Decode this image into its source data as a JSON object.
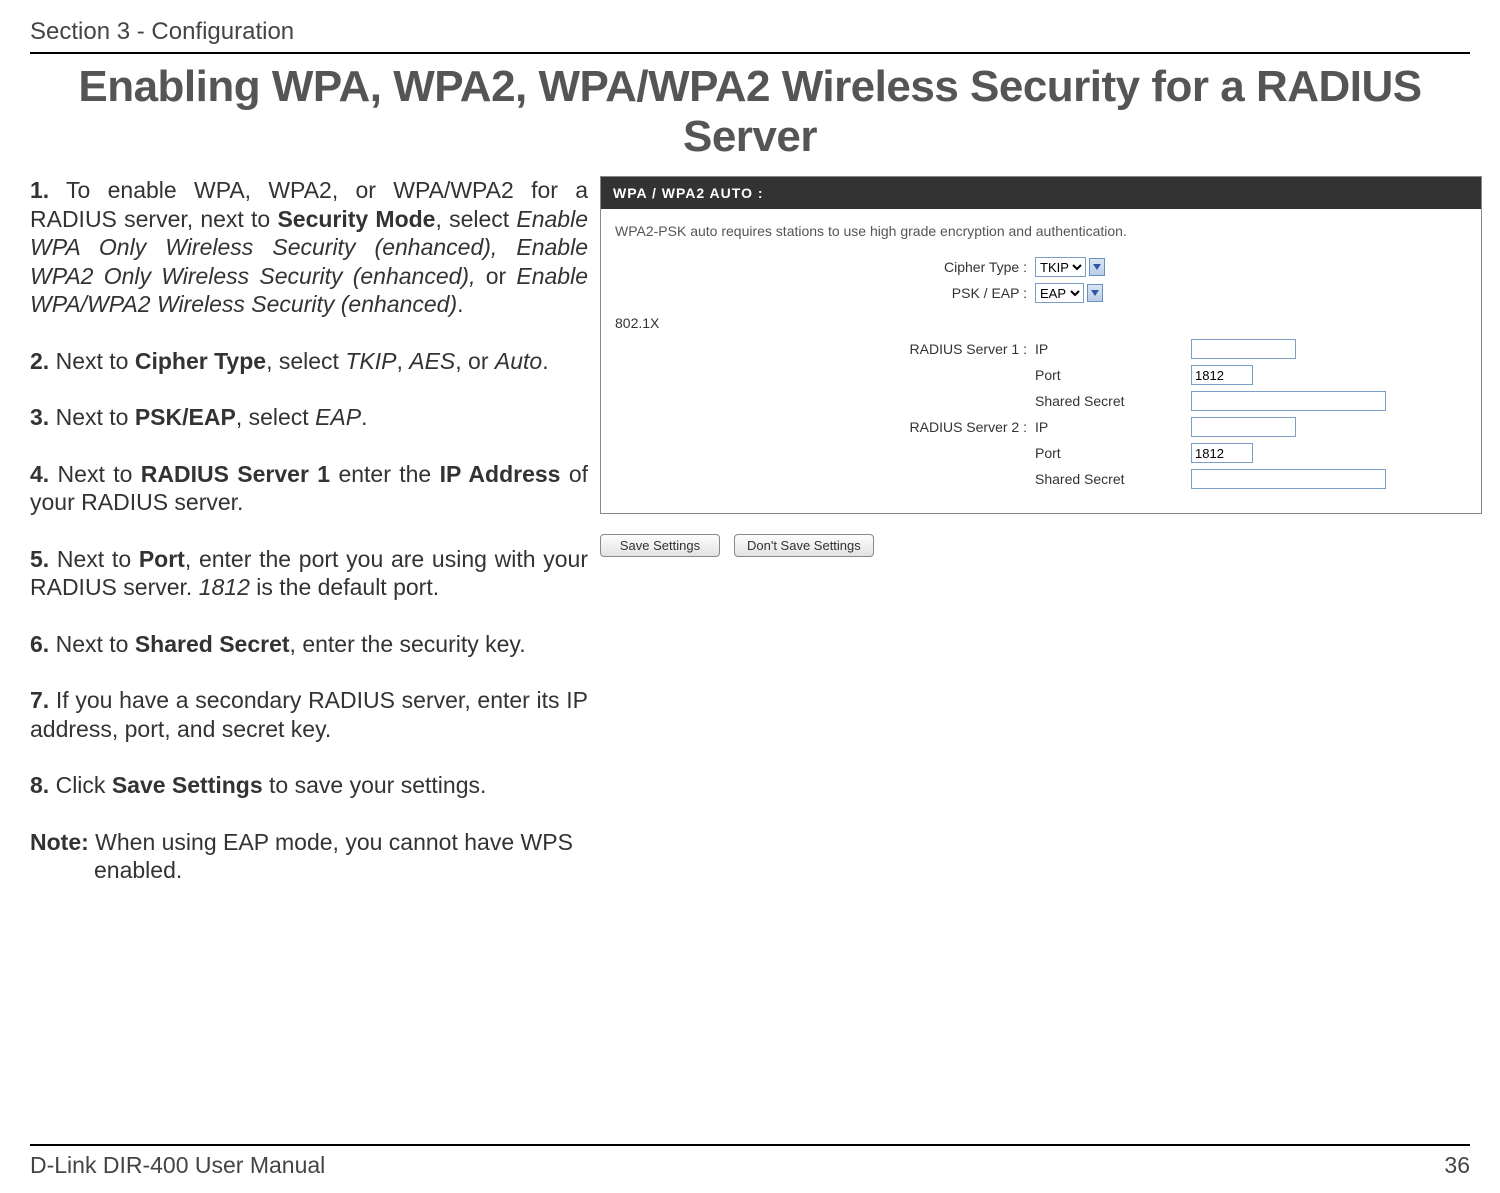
{
  "section_header": "Section 3 - Configuration",
  "page_title": "Enabling WPA, WPA2, WPA/WPA2 Wireless Security for a RADIUS Server",
  "steps": {
    "s1_num": "1.",
    "s1_a": " To enable WPA, WPA2, or WPA/WPA2 for a RADIUS server, next to ",
    "s1_b": "Security Mode",
    "s1_c": ", select ",
    "s1_d": "Enable WPA Only Wireless Security (enhanced), Enable WPA2 Only Wireless Security (enhanced),",
    "s1_e": " or ",
    "s1_f": "Enable WPA/WPA2 Wireless Security (enhanced)",
    "s1_g": ".",
    "s2_num": "2.",
    "s2_a": " Next to ",
    "s2_b": "Cipher Type",
    "s2_c": ", select ",
    "s2_d": "TKIP",
    "s2_e": ", ",
    "s2_f": "AES",
    "s2_g": ", or ",
    "s2_h": "Auto",
    "s2_i": ".",
    "s3_num": "3.",
    "s3_a": " Next to ",
    "s3_b": "PSK/EAP",
    "s3_c": ", select ",
    "s3_d": "EAP",
    "s3_e": ".",
    "s4_num": "4.",
    "s4_a": " Next to ",
    "s4_b": "RADIUS Server 1",
    "s4_c": " enter the ",
    "s4_d": "IP Address",
    "s4_e": " of your RADIUS server.",
    "s5_num": "5.",
    "s5_a": " Next to ",
    "s5_b": "Port",
    "s5_c": ", enter the port you are using with your RADIUS server. ",
    "s5_d": "1812",
    "s5_e": " is the default port.",
    "s6_num": "6.",
    "s6_a": " Next to ",
    "s6_b": "Shared Secret",
    "s6_c": ", enter the security key.",
    "s7_num": "7.",
    "s7_a": " If you have a secondary RADIUS server, enter its IP address, port, and secret key.",
    "s8_num": "8.",
    "s8_a": " Click ",
    "s8_b": "Save Settings",
    "s8_c": " to save your settings.",
    "note_lbl": "Note:",
    "note_a": " When using EAP mode, you cannot have WPS ",
    "note_b": "enabled."
  },
  "panel": {
    "title": "WPA / WPA2 AUTO :",
    "desc": "WPA2-PSK auto requires stations to use high grade encryption and authentication.",
    "cipher_label": "Cipher Type :",
    "cipher_value": "TKIP",
    "psk_label": "PSK / EAP :",
    "psk_value": "EAP",
    "x_label": "802.1X",
    "r1_label": "RADIUS Server 1 :",
    "r2_label": "RADIUS Server 2 :",
    "ip_label": "IP",
    "port_label": "Port",
    "secret_label": "Shared Secret",
    "port_value": "1812",
    "save_btn": "Save Settings",
    "dont_save_btn": "Don't Save Settings"
  },
  "footer": {
    "left": "D-Link DIR-400 User Manual",
    "right": "36"
  }
}
